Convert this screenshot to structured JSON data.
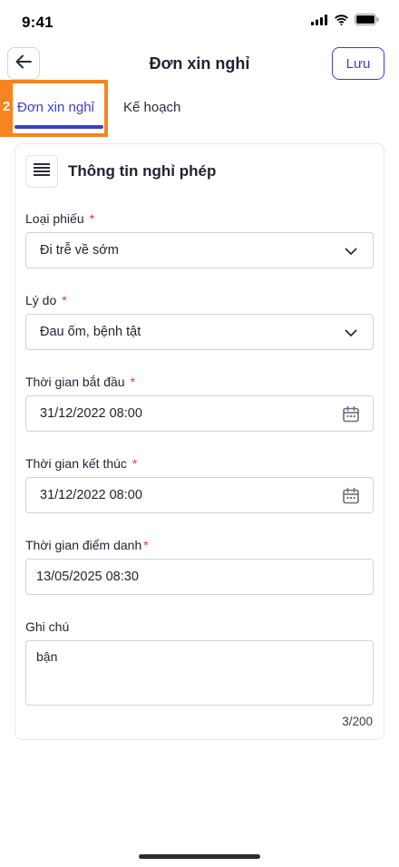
{
  "status_bar": {
    "time": "9:41"
  },
  "nav": {
    "title": "Đơn xin nghỉ",
    "save_label": "Lưu"
  },
  "tabs": {
    "marker": "2",
    "items": [
      {
        "label": "Đơn xin nghỉ"
      },
      {
        "label": "Kế hoạch"
      }
    ]
  },
  "form": {
    "card_title": "Thông tin nghỉ phép",
    "fields": [
      {
        "label": "Loại phiếu",
        "value": "Đi trễ về sớm",
        "icon": "chevron-down-icon"
      },
      {
        "label": "Lý do",
        "value": "Đau ốm, bệnh tật",
        "icon": "chevron-down-icon"
      },
      {
        "label": "Thời gian bắt đầu",
        "value": "31/12/2022 08:00",
        "icon": "calendar-icon"
      },
      {
        "label": "Thời gian kết thúc",
        "value": "31/12/2022 08:00",
        "icon": "calendar-icon"
      },
      {
        "label": "Thời gian điểm danh",
        "value": "13/05/2025 08:30"
      },
      {
        "label": "Ghi chú",
        "value": "bận"
      }
    ],
    "required_mark": "*",
    "char_counter": "3/200"
  },
  "colors": {
    "accent": "#3b3fc8",
    "highlight": "#f7841f",
    "required": "#e5343d"
  }
}
